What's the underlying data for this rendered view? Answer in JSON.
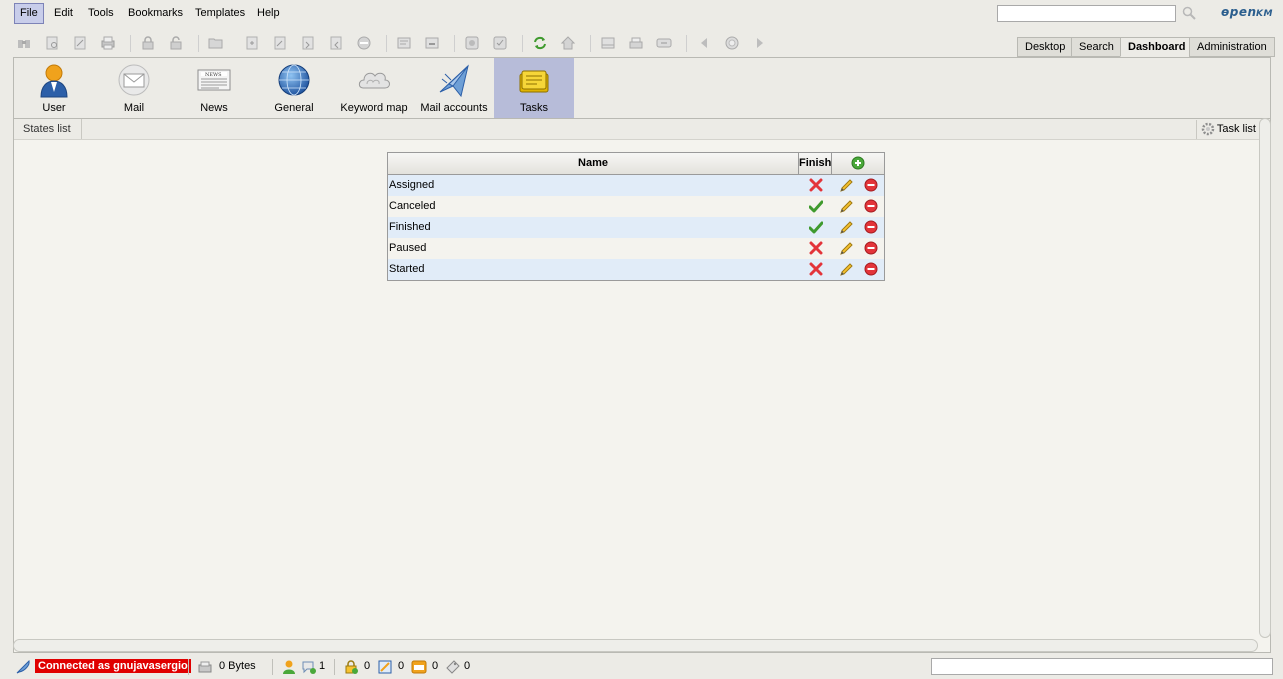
{
  "menu": {
    "file": "File",
    "edit": "Edit",
    "tools": "Tools",
    "bookmarks": "Bookmarks",
    "templates": "Templates",
    "help": "Help"
  },
  "search": {
    "value": "",
    "placeholder": ""
  },
  "brand": {
    "logo_text": "openKM"
  },
  "workspace_tabs": {
    "desktop": "Desktop",
    "search": "Search",
    "dashboard": "Dashboard",
    "administration": "Administration",
    "active": "Dashboard"
  },
  "dashboard_tabs": [
    {
      "label": "User",
      "icon": "user-icon"
    },
    {
      "label": "Mail",
      "icon": "mail-icon"
    },
    {
      "label": "News",
      "icon": "news-icon"
    },
    {
      "label": "General",
      "icon": "globe-icon"
    },
    {
      "label": "Keyword map",
      "icon": "cloud-icon"
    },
    {
      "label": "Mail accounts",
      "icon": "mail-accounts-icon"
    },
    {
      "label": "Tasks",
      "icon": "tasks-icon",
      "active": true
    }
  ],
  "breadcrumb": {
    "label": "States list"
  },
  "task_list_button": {
    "label": "Task list",
    "icon": "gear-icon"
  },
  "states_table": {
    "columns": {
      "name": "Name",
      "finish": "Finish"
    },
    "rows": [
      {
        "name": "Assigned",
        "finish": false
      },
      {
        "name": "Canceled",
        "finish": true
      },
      {
        "name": "Finished",
        "finish": true
      },
      {
        "name": "Paused",
        "finish": false
      },
      {
        "name": "Started",
        "finish": false
      }
    ]
  },
  "status": {
    "connected": "Connected as gnujavasergio",
    "storage": "0 Bytes",
    "users_count": "1",
    "locked_count": "0",
    "checkout_count": "0",
    "mail_count": "0",
    "subscriptions_count": "0",
    "message_value": ""
  },
  "colors": {
    "accent_selected": "#b7bcd9",
    "row_alt": "#e1ecf8",
    "connected_bg": "#e00000",
    "check_green": "#3f9a2e",
    "cross_red": "#e3343a"
  }
}
